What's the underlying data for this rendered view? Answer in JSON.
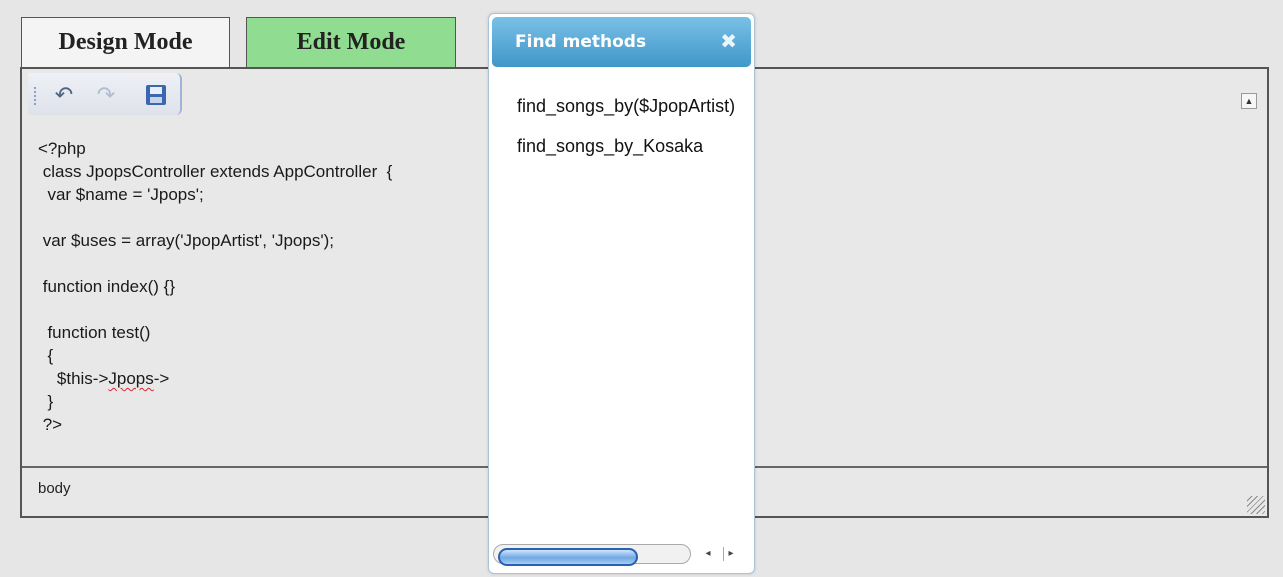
{
  "tabs": {
    "design": "Design Mode",
    "edit": "Edit Mode"
  },
  "toolbar": {
    "undo_icon": "↶",
    "redo_icon": "↷",
    "scroll_up_icon": "▲"
  },
  "code_lines": [
    "<?php",
    " class JpopsController extends AppController  {",
    "  var $name = 'Jpops';",
    "",
    " var $uses = array('JpopArtist', 'Jpops');",
    "",
    " function index() {}",
    "",
    "  function test()",
    "  {",
    "    $this->",
    "  }",
    " ?>"
  ],
  "code_squiggle_word": "Jpops",
  "code_squiggle_tail": "->",
  "status_path": "body",
  "popup": {
    "title": "Find methods",
    "close_icon": "✖",
    "methods": [
      "find_songs_by($JpopArtist)",
      "find_songs_by_Kosaka"
    ],
    "scroll_left_icon": "◂",
    "scroll_right_icon": "▸"
  },
  "colors": {
    "edit_tab": "#90dc90",
    "popup_header": "#3f97c9",
    "scroll_thumb": "#6fa8e4"
  }
}
